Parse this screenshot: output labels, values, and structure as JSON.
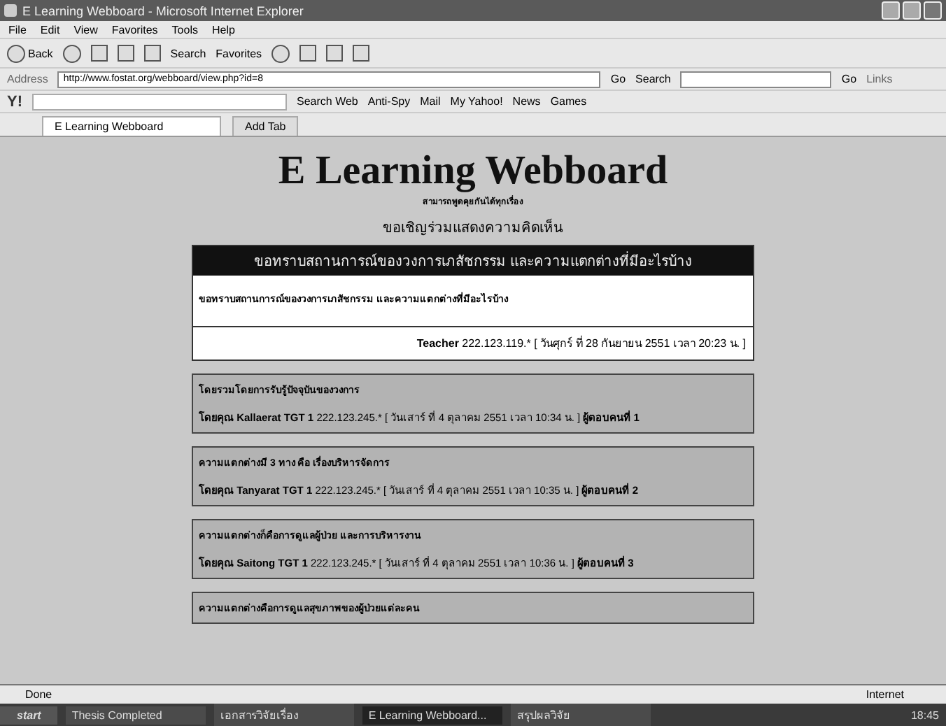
{
  "window": {
    "title": "E Learning Webboard - Microsoft Internet Explorer"
  },
  "menu": [
    "File",
    "Edit",
    "View",
    "Favorites",
    "Tools",
    "Help"
  ],
  "toolbar": {
    "back": "Back",
    "search": "Search",
    "favorites": "Favorites"
  },
  "address": {
    "label": "Address",
    "value": "http://www.fostat.org/webboard/view.php?id=8",
    "go": "Go",
    "search": "Search",
    "go2": "Go",
    "links": "Links"
  },
  "yahoo_bar": {
    "logo": "Y!",
    "items": [
      "Search Web",
      "Anti-Spy",
      "Mail",
      "My Yahoo!",
      "News",
      "Games"
    ]
  },
  "tabs": [
    {
      "label": "E Learning Webboard",
      "selected": true
    },
    {
      "label": "Add Tab",
      "selected": false
    }
  ],
  "page": {
    "title": "E Learning Webboard",
    "subtitle": "สามารถพูดคุยกันได้ทุกเรื่อง",
    "invite": "ขอเชิญร่วมแสดงความคิดเห็น",
    "topic": {
      "title": "ขอทราบสถานการณ์ของวงการเภสัชกรรม และความแตกต่างที่มีอะไรบ้าง",
      "body": "ขอทราบสถานการณ์ของวงการเภสัชกรรม และความแตกต่างที่มีอะไรบ้าง",
      "author": "Teacher",
      "meta": "222.123.119.* [ วันศุกร์ ที่ 28 กันยายน 2551 เวลา 20:23 น. ]"
    },
    "replies": [
      {
        "text": "โดยรวมโดยการรับรู้ปัจจุบันของวงการ",
        "author": "โดยคุณ Kallaerat TGT 1",
        "meta": "222.123.245.* [ วันเสาร์ ที่ 4 ตุลาคม 2551 เวลา 10:34 น. ]",
        "number": "ผู้ตอบคนที่ 1"
      },
      {
        "text": "ความแตกต่างมี 3 ทาง คือ เรื่องบริหารจัดการ",
        "author": "โดยคุณ Tanyarat TGT 1",
        "meta": "222.123.245.* [ วันเสาร์ ที่ 4 ตุลาคม 2551 เวลา 10:35 น. ]",
        "number": "ผู้ตอบคนที่ 2"
      },
      {
        "text": "ความแตกต่างก็คือการดูแลผู้ป่วย และการบริหารงาน",
        "author": "โดยคุณ Saitong TGT 1",
        "meta": "222.123.245.* [ วันเสาร์ ที่ 4 ตุลาคม 2551 เวลา 10:36 น. ]",
        "number": "ผู้ตอบคนที่ 3"
      },
      {
        "text": "ความแตกต่างคือการดูแลสุขภาพของผู้ป่วยแต่ละคน"
      }
    ]
  },
  "status_bar": {
    "text": "Done",
    "zone": "Internet"
  },
  "taskbar": {
    "start": "start",
    "items": [
      "Thesis Completed",
      "เอกสารวิจัยเรื่อง",
      "E Learning Webboard...",
      "สรุปผลวิจัย"
    ],
    "clock": "18:45"
  }
}
